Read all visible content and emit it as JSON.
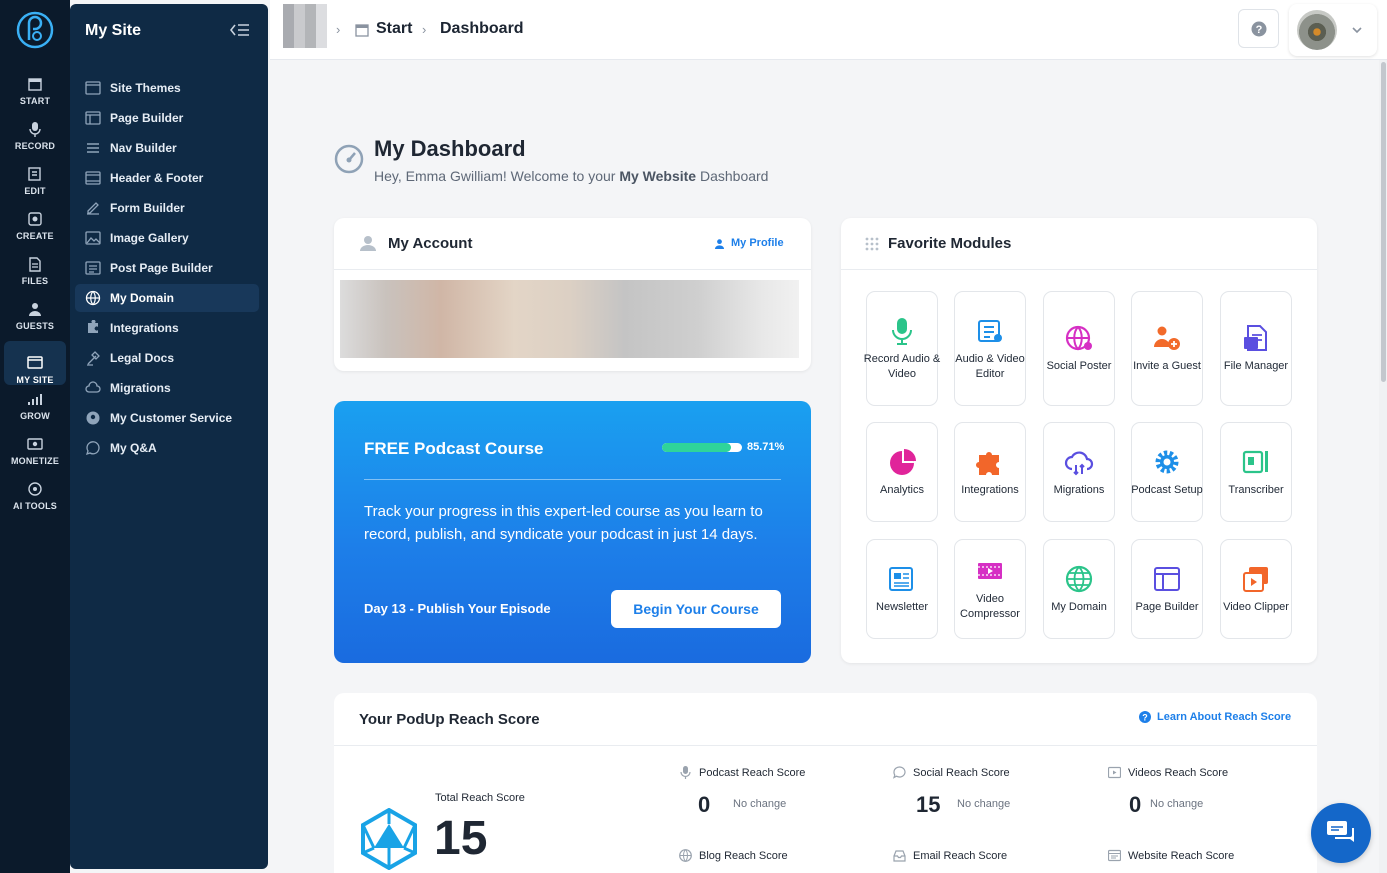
{
  "rail": {
    "items": [
      {
        "label": "START",
        "icon": "start-icon"
      },
      {
        "label": "RECORD",
        "icon": "microphone-icon"
      },
      {
        "label": "EDIT",
        "icon": "edit-icon"
      },
      {
        "label": "CREATE",
        "icon": "create-icon"
      },
      {
        "label": "FILES",
        "icon": "files-icon"
      },
      {
        "label": "GUESTS",
        "icon": "guests-icon"
      },
      {
        "label": "MY SITE",
        "icon": "my-site-icon"
      },
      {
        "label": "GROW",
        "icon": "grow-icon"
      },
      {
        "label": "MONETIZE",
        "icon": "monetize-icon"
      },
      {
        "label": "AI TOOLS",
        "icon": "ai-tools-icon"
      }
    ],
    "active": "MY SITE"
  },
  "sidebar": {
    "title": "My Site",
    "items": [
      {
        "label": "Site Themes"
      },
      {
        "label": "Page Builder"
      },
      {
        "label": "Nav Builder"
      },
      {
        "label": "Header & Footer"
      },
      {
        "label": "Form Builder"
      },
      {
        "label": "Image Gallery"
      },
      {
        "label": "Post Page Builder"
      },
      {
        "label": "My Domain"
      },
      {
        "label": "Integrations"
      },
      {
        "label": "Legal Docs"
      },
      {
        "label": "Migrations"
      },
      {
        "label": "My Customer Service"
      },
      {
        "label": "My Q&A"
      }
    ],
    "active": "My Domain"
  },
  "breadcrumb": {
    "start": "Start",
    "current": "Dashboard"
  },
  "dashboard": {
    "title": "My Dashboard",
    "greeting_pre": "Hey, Emma Gwilliam! Welcome to your ",
    "greeting_bold": "My Website",
    "greeting_post": " Dashboard"
  },
  "account": {
    "title": "My Account",
    "profile_link": "My Profile"
  },
  "course": {
    "title": "FREE Podcast Course",
    "progress": 0.8571,
    "progress_label": "85.71%",
    "description": "Track your progress in this expert-led course as you learn to record, publish, and syndicate your podcast in just 14 days.",
    "day_label": "Day 13 - Publish Your Episode",
    "button": "Begin Your Course"
  },
  "favorites": {
    "title": "Favorite Modules",
    "tiles": [
      {
        "label": "Record Audio & Video",
        "icon": "microphone-icon",
        "color": "#2bc48a"
      },
      {
        "label": "Audio & Video Editor",
        "icon": "editor-icon",
        "color": "#1d8fe8"
      },
      {
        "label": "Social Poster",
        "icon": "globe-share-icon",
        "color": "#d62fc4"
      },
      {
        "label": "Invite a Guest",
        "icon": "invite-guest-icon",
        "color": "#f26a2a"
      },
      {
        "label": "File Manager",
        "icon": "file-manager-icon",
        "color": "#5a4fe0"
      },
      {
        "label": "Analytics",
        "icon": "pie-chart-icon",
        "color": "#e0249a"
      },
      {
        "label": "Integrations",
        "icon": "puzzle-icon",
        "color": "#f2662a"
      },
      {
        "label": "Migrations",
        "icon": "cloud-sync-icon",
        "color": "#5a4fe0"
      },
      {
        "label": "Podcast Setup",
        "icon": "gear-icon",
        "color": "#1d8fe8"
      },
      {
        "label": "Transcriber",
        "icon": "transcriber-icon",
        "color": "#2bc48a"
      },
      {
        "label": "Newsletter",
        "icon": "newsletter-icon",
        "color": "#1d8fe8"
      },
      {
        "label": "Video Compressor",
        "icon": "video-compress-icon",
        "color": "#d62fc4"
      },
      {
        "label": "My Domain",
        "icon": "globe-icon",
        "color": "#2bc48a"
      },
      {
        "label": "Page Builder",
        "icon": "page-builder-icon",
        "color": "#5a4fe0"
      },
      {
        "label": "Video Clipper",
        "icon": "video-clipper-icon",
        "color": "#f2662a"
      }
    ]
  },
  "reach": {
    "title": "Your PodUp Reach Score",
    "learn_link": "Learn About Reach Score",
    "total_label": "Total Reach Score",
    "total_value": "15",
    "metrics": [
      {
        "label": "Podcast Reach Score",
        "value": "0",
        "change": "No change"
      },
      {
        "label": "Social Reach Score",
        "value": "15",
        "change": "No change"
      },
      {
        "label": "Videos Reach Score",
        "value": "0",
        "change": "No change"
      },
      {
        "label": "Blog Reach Score"
      },
      {
        "label": "Email Reach Score"
      },
      {
        "label": "Website Reach Score"
      }
    ]
  }
}
